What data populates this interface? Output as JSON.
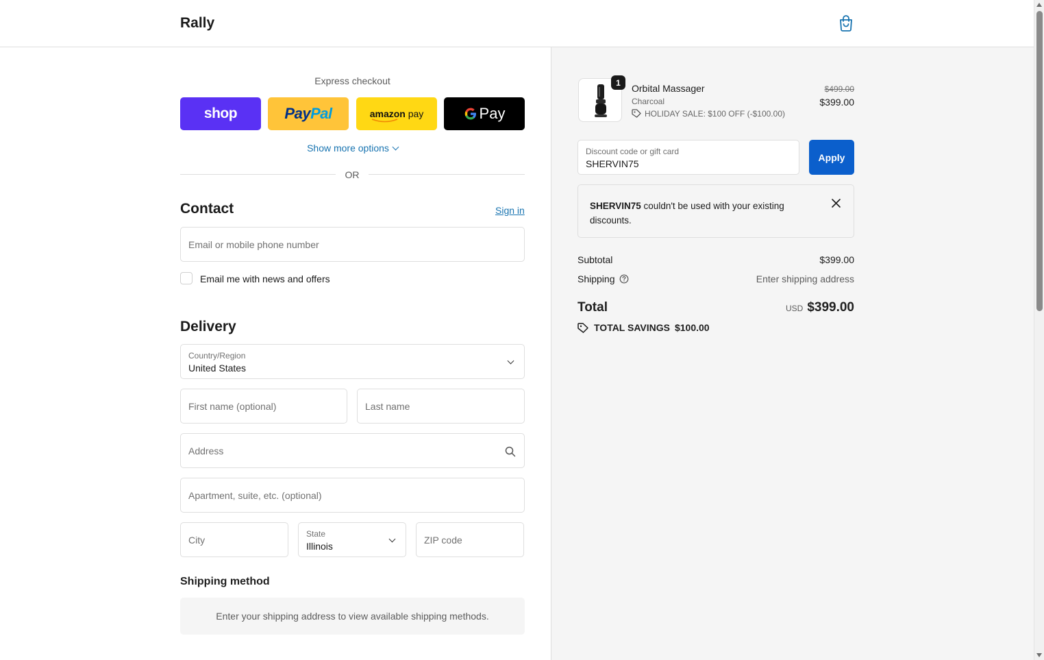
{
  "header": {
    "brand": "Rally",
    "cart_icon": "shopping-bag-icon"
  },
  "express": {
    "title": "Express checkout",
    "shop_label": "shop",
    "paypal_label_1": "Pay",
    "paypal_label_2": "Pal",
    "amazon_label_1": "amazon",
    "amazon_label_2": " pay",
    "gpay_g": "G",
    "gpay_label": "Pay",
    "show_more": "Show more options",
    "or": "OR"
  },
  "contact": {
    "title": "Contact",
    "sign_in": "Sign in",
    "email_placeholder": "Email or mobile phone number",
    "news_label": "Email me with news and offers"
  },
  "delivery": {
    "title": "Delivery",
    "country_label": "Country/Region",
    "country_value": "United States",
    "first_name": "First name (optional)",
    "last_name": "Last name",
    "address": "Address",
    "apartment": "Apartment, suite, etc. (optional)",
    "city": "City",
    "state_label": "State",
    "state_value": "Illinois",
    "zip": "ZIP code"
  },
  "shipping_method": {
    "title": "Shipping method",
    "info": "Enter your shipping address to view available shipping methods."
  },
  "order": {
    "quantity": "1",
    "product_name": "Orbital Massager",
    "variant": "Charcoal",
    "discount_line": "HOLIDAY SALE: $100 OFF (-$100.00)",
    "original_price": "$499.00",
    "price": "$399.00",
    "discount_field_label": "Discount code or gift card",
    "discount_field_value": "SHERVIN75",
    "apply_label": "Apply",
    "notice_code": "SHERVIN75",
    "notice_text": " couldn't be used with your existing discounts.",
    "subtotal_label": "Subtotal",
    "subtotal_value": "$399.00",
    "shipping_label": "Shipping",
    "shipping_value": "Enter shipping address",
    "total_label": "Total",
    "total_currency": "USD",
    "total_value": "$399.00",
    "savings_label": "TOTAL SAVINGS",
    "savings_value": "$100.00"
  },
  "colors": {
    "accent": "#0b5fcc",
    "link": "#1773b0",
    "shop": "#5a31f4",
    "paypal": "#ffc439",
    "amazon": "#ffd814"
  }
}
